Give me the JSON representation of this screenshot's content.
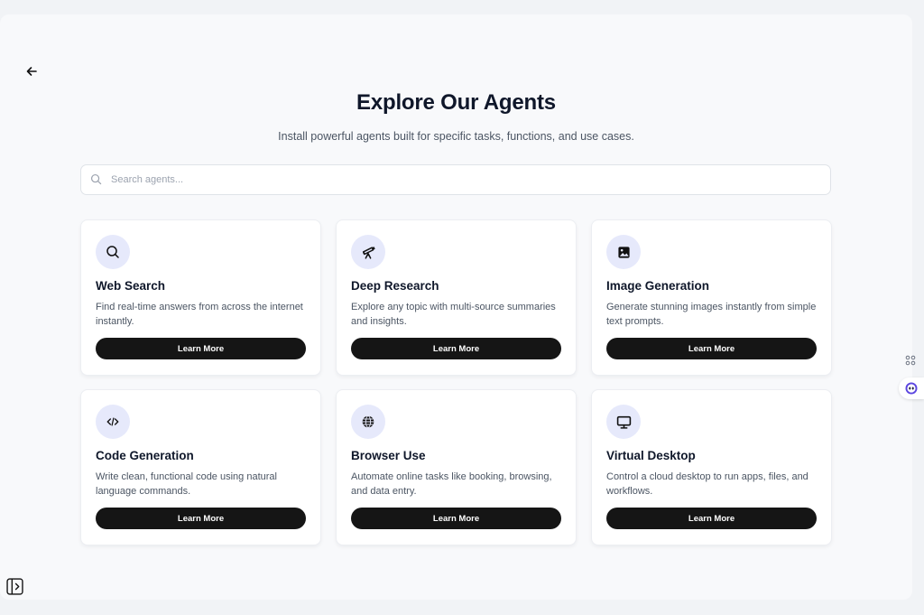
{
  "header": {
    "title": "Explore Our Agents",
    "subtitle": "Install powerful agents built for specific tasks, functions, and use cases."
  },
  "search": {
    "placeholder": "Search agents...",
    "value": ""
  },
  "agents": [
    {
      "name": "Web Search",
      "icon": "search-icon",
      "description": "Find real-time answers from across the internet instantly.",
      "button": "Learn More"
    },
    {
      "name": "Deep Research",
      "icon": "telescope-icon",
      "description": "Explore any topic with multi-source summaries and insights.",
      "button": "Learn More"
    },
    {
      "name": "Image Generation",
      "icon": "image-icon",
      "description": "Generate stunning images instantly from simple text prompts.",
      "button": "Learn More"
    },
    {
      "name": "Code Generation",
      "icon": "code-icon",
      "description": "Write clean, functional code using natural language commands.",
      "button": "Learn More"
    },
    {
      "name": "Browser Use",
      "icon": "globe-icon",
      "description": "Automate online tasks like booking, browsing, and data entry.",
      "button": "Learn More"
    },
    {
      "name": "Virtual Desktop",
      "icon": "monitor-icon",
      "description": "Control a cloud desktop to run apps, files, and workflows.",
      "button": "Learn More"
    }
  ],
  "icons": {
    "back": "arrow-left-icon",
    "search": "search-icon",
    "side_tool_1": "command-icon",
    "side_tool_2": "assistant-bot-icon",
    "sidebar_toggle": "sidebar-toggle-icon"
  },
  "colors": {
    "accent": "#151515",
    "icon_bg": "#e6e9fb",
    "bot_accent": "#5b45e0"
  }
}
